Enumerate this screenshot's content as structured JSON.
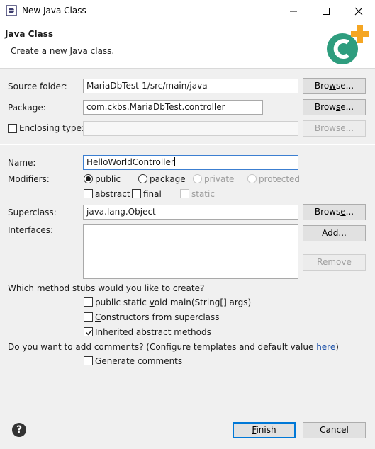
{
  "window": {
    "title": "New Java Class"
  },
  "header": {
    "title": "Java Class",
    "description": "Create a new Java class."
  },
  "source_folder": {
    "label": "Source folder:",
    "value": "MariaDbTest-1/src/main/java",
    "browse_label": "Browse..."
  },
  "package": {
    "label": "Package:",
    "value": "com.ckbs.MariaDbTest.controller",
    "browse_label": "Browse..."
  },
  "enclosing_type": {
    "label": "Enclosing type:",
    "value": "",
    "browse_label": "Browse...",
    "checked": false
  },
  "name": {
    "label": "Name:",
    "value": "HelloWorldController"
  },
  "modifiers": {
    "label": "Modifiers:",
    "public": "public",
    "package": "package",
    "private": "private",
    "protected": "protected",
    "abstract": "abstract",
    "final": "final",
    "static": "static",
    "selected": "public"
  },
  "superclass": {
    "label": "Superclass:",
    "value": "java.lang.Object",
    "browse_label": "Browse..."
  },
  "interfaces": {
    "label": "Interfaces:",
    "add_label": "Add...",
    "remove_label": "Remove",
    "items": []
  },
  "method_stubs": {
    "question": "Which method stubs would you like to create?",
    "main": {
      "label": "public static void main(String[] args)",
      "checked": false
    },
    "constructors": {
      "label": "Constructors from superclass",
      "checked": false
    },
    "inherited": {
      "label": "Inherited abstract methods",
      "checked": true
    }
  },
  "comments": {
    "question": "Do you want to add comments? (Configure templates and default value ",
    "link": "here",
    "closing": ")",
    "generate": {
      "label": "Generate comments",
      "checked": false
    }
  },
  "footer": {
    "finish_label": "Finish",
    "cancel_label": "Cancel"
  },
  "colors": {
    "brand_green": "#2e9d7e",
    "plus_orange": "#f5a623",
    "focus_blue": "#3c7fd1"
  }
}
